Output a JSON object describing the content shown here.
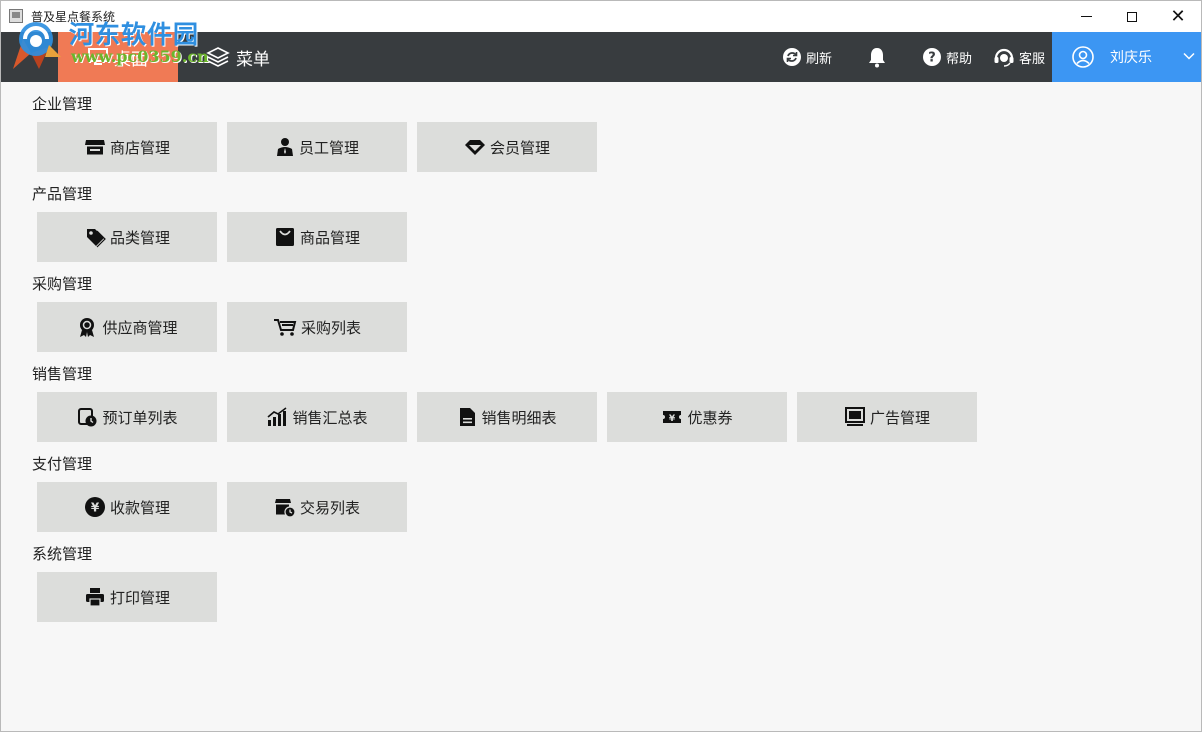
{
  "window": {
    "title": "普及星点餐系统",
    "controls": [
      "minimize",
      "maximize",
      "close"
    ]
  },
  "watermark": {
    "name": "河东软件园",
    "url": "www.pc0359.cn"
  },
  "nav": {
    "desktop_label": "桌面",
    "menu_label": "菜单",
    "refresh_label": "刷新",
    "help_label": "帮助",
    "service_label": "客服",
    "user_name": "刘庆乐",
    "active_color": "#f07a55",
    "user_color": "#3c96f3",
    "bar_color": "#383c3f"
  },
  "sections": [
    {
      "title": "企业管理",
      "items": [
        {
          "label": "商店管理",
          "icon": "store-icon"
        },
        {
          "label": "员工管理",
          "icon": "employee-icon"
        },
        {
          "label": "会员管理",
          "icon": "diamond-icon"
        }
      ]
    },
    {
      "title": "产品管理",
      "items": [
        {
          "label": "品类管理",
          "icon": "tag-icon"
        },
        {
          "label": "商品管理",
          "icon": "bag-icon"
        }
      ]
    },
    {
      "title": "采购管理",
      "items": [
        {
          "label": "供应商管理",
          "icon": "award-icon"
        },
        {
          "label": "采购列表",
          "icon": "cart-icon"
        }
      ]
    },
    {
      "title": "销售管理",
      "items": [
        {
          "label": "预订单列表",
          "icon": "reservation-icon"
        },
        {
          "label": "销售汇总表",
          "icon": "chart-icon"
        },
        {
          "label": "销售明细表",
          "icon": "file-icon"
        },
        {
          "label": "优惠券",
          "icon": "coupon-icon"
        },
        {
          "label": "广告管理",
          "icon": "monitor-icon"
        }
      ]
    },
    {
      "title": "支付管理",
      "items": [
        {
          "label": "收款管理",
          "icon": "yen-icon"
        },
        {
          "label": "交易列表",
          "icon": "transaction-icon"
        }
      ]
    },
    {
      "title": "系统管理",
      "items": [
        {
          "label": "打印管理",
          "icon": "printer-icon"
        }
      ]
    }
  ]
}
